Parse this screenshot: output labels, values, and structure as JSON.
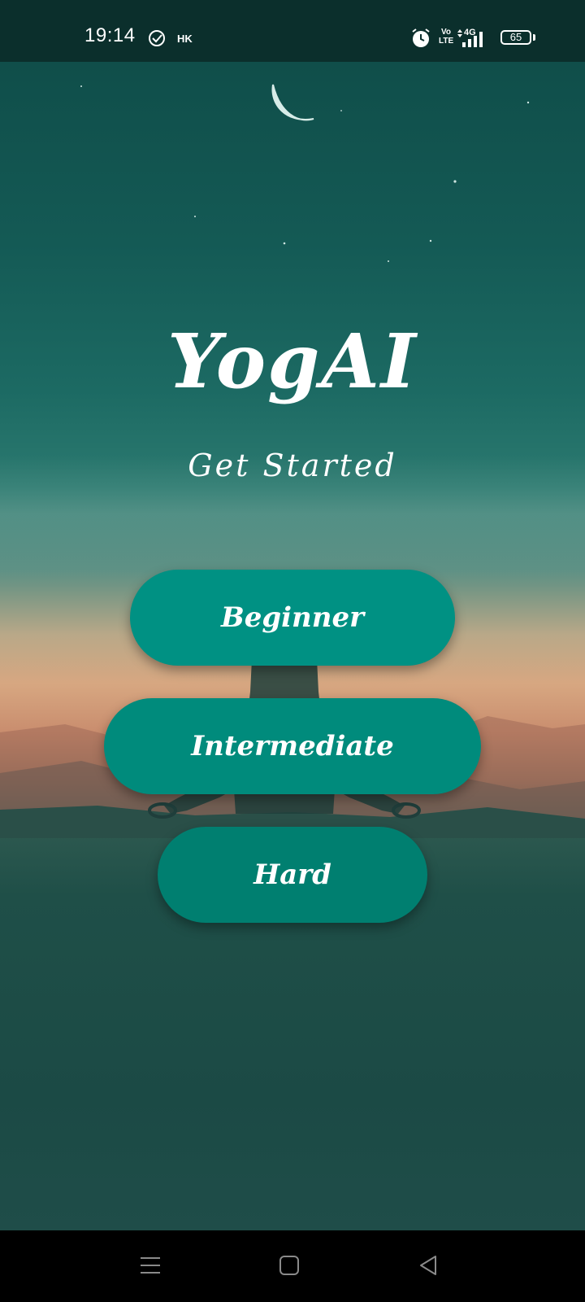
{
  "status_bar": {
    "time": "19:14",
    "carrier": "HK",
    "volte": [
      "Vo",
      "LTE"
    ],
    "network": "4G",
    "battery": "65",
    "icons": [
      "check-circle-icon",
      "alarm-icon",
      "volte-icon",
      "signal-icon",
      "battery-icon"
    ]
  },
  "app": {
    "title": "YogAI",
    "subtitle": "Get Started"
  },
  "levels": {
    "beginner": "Beginner",
    "intermediate": "Intermediate",
    "hard": "Hard"
  },
  "colors": {
    "button": "#009183",
    "status_bar": "#0b2f2c",
    "nav_bar": "#000000"
  },
  "nav_bar": {
    "icons": [
      "menu-icon",
      "home-icon",
      "back-icon"
    ]
  }
}
